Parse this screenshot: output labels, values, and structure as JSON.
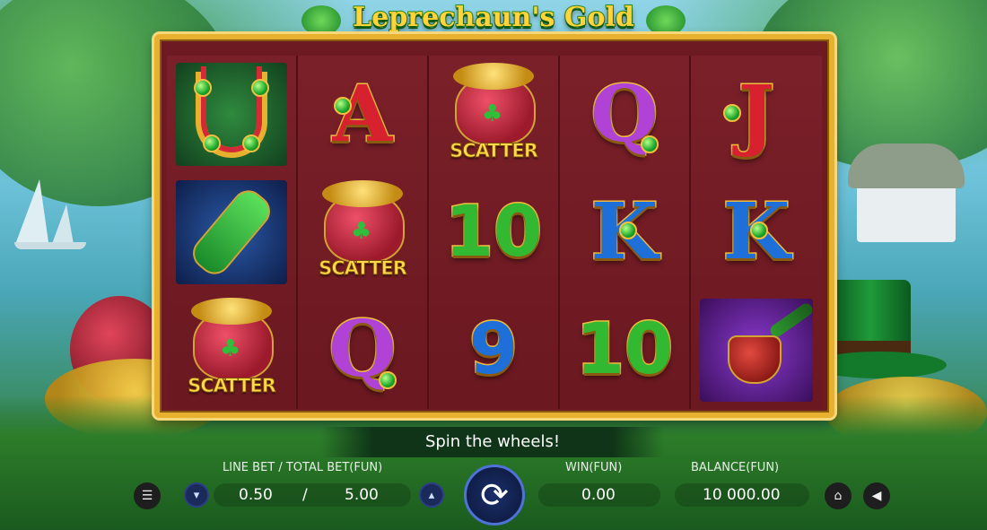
{
  "game": {
    "title": "Leprechaun's Gold"
  },
  "reels": [
    [
      {
        "symbol": "horseshoe",
        "label": ""
      },
      {
        "symbol": "violin",
        "label": ""
      },
      {
        "symbol": "scatter",
        "label": "SCATTER"
      }
    ],
    [
      {
        "symbol": "letter",
        "label": "A",
        "color": "#d8212e"
      },
      {
        "symbol": "scatter",
        "label": "SCATTER"
      },
      {
        "symbol": "letter",
        "label": "Q",
        "color": "#b042d6"
      }
    ],
    [
      {
        "symbol": "scatter",
        "label": "SCATTER"
      },
      {
        "symbol": "number",
        "label": "10",
        "color": "#33b832"
      },
      {
        "symbol": "number",
        "label": "9",
        "color": "#1f6fd8"
      }
    ],
    [
      {
        "symbol": "letter",
        "label": "Q",
        "color": "#b042d6"
      },
      {
        "symbol": "letter",
        "label": "K",
        "color": "#1f6fd8"
      },
      {
        "symbol": "number",
        "label": "10",
        "color": "#33b832"
      }
    ],
    [
      {
        "symbol": "letter",
        "label": "J",
        "color": "#d8212e"
      },
      {
        "symbol": "letter",
        "label": "K",
        "color": "#1f6fd8"
      },
      {
        "symbol": "pipe",
        "label": ""
      }
    ]
  ],
  "status": {
    "message": "Spin the wheels!"
  },
  "controls": {
    "menu_icon": "menu-icon",
    "bet_label": "LINE BET / TOTAL BET(FUN)",
    "line_bet": "0.50",
    "separator": "/",
    "total_bet": "5.00",
    "decrease_icon": "chevron-down-icon",
    "increase_icon": "chevron-up-icon",
    "spin_icon": "refresh-arrows-icon",
    "win_label": "WIN(FUN)",
    "win_value": "0.00",
    "balance_label": "BALANCE(FUN)",
    "balance_value": "10 000.00",
    "home_icon": "home-icon",
    "sound_icon": "speaker-icon"
  },
  "colors": {
    "frame_gold": "#e7b02e",
    "reel_bg": "#6e1a22",
    "spin_accent": "#4f72d6"
  }
}
